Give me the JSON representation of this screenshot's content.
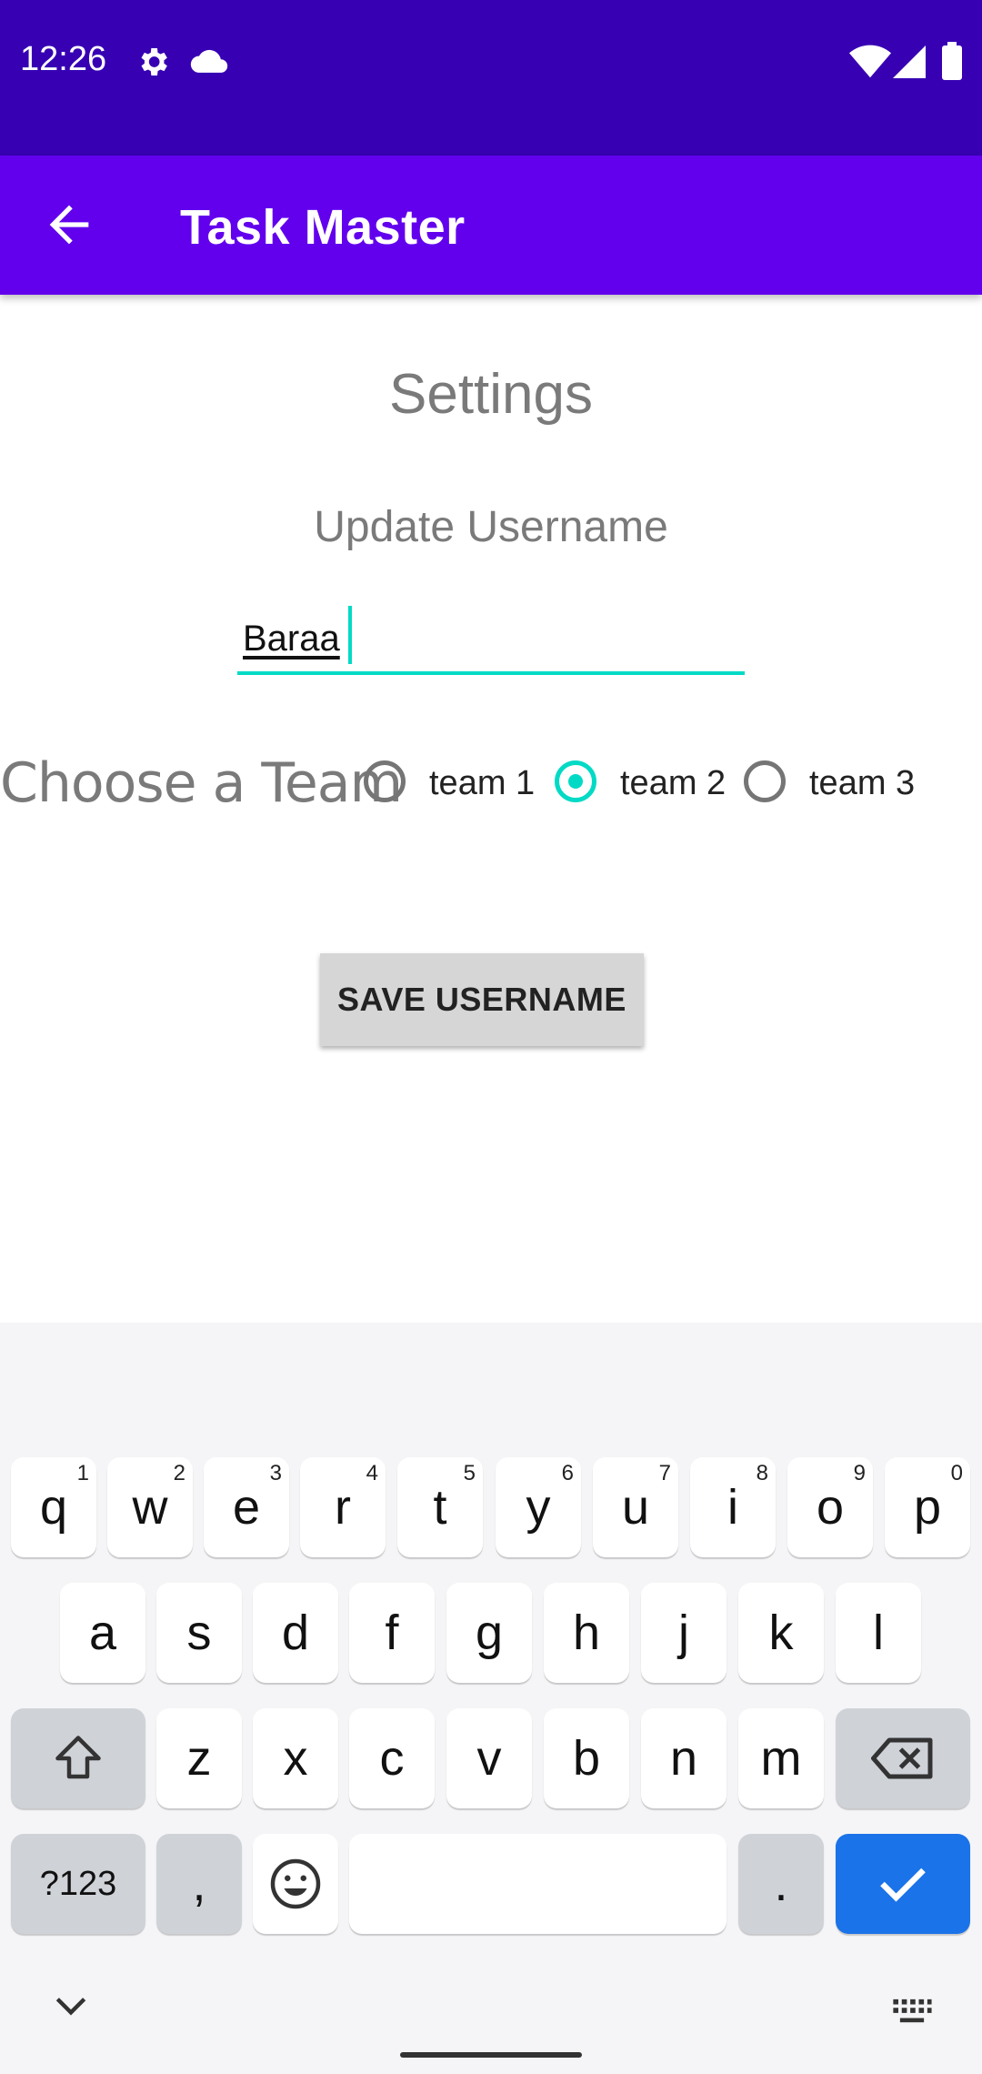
{
  "status_bar": {
    "time": "12:26",
    "icons": [
      "gear-icon",
      "cloud-icon",
      "wifi-icon",
      "signal-icon",
      "battery-icon"
    ]
  },
  "app_bar": {
    "title": "Task Master",
    "back_icon": "arrow-back-icon"
  },
  "page": {
    "heading": "Settings",
    "username_label": "Update Username",
    "username_value": "Baraa",
    "team_label": "Choose a Team",
    "teams": [
      {
        "label": "team 1",
        "checked": false
      },
      {
        "label": "team 2",
        "checked": true
      },
      {
        "label": "team 3",
        "checked": false
      }
    ],
    "save_button": "SAVE USERNAME"
  },
  "keyboard": {
    "row1": [
      {
        "key": "q",
        "hint": "1"
      },
      {
        "key": "w",
        "hint": "2"
      },
      {
        "key": "e",
        "hint": "3"
      },
      {
        "key": "r",
        "hint": "4"
      },
      {
        "key": "t",
        "hint": "5"
      },
      {
        "key": "y",
        "hint": "6"
      },
      {
        "key": "u",
        "hint": "7"
      },
      {
        "key": "i",
        "hint": "8"
      },
      {
        "key": "o",
        "hint": "9"
      },
      {
        "key": "p",
        "hint": "0"
      }
    ],
    "row2": [
      "a",
      "s",
      "d",
      "f",
      "g",
      "h",
      "j",
      "k",
      "l"
    ],
    "row3": [
      "z",
      "x",
      "c",
      "v",
      "b",
      "n",
      "m"
    ],
    "symbols_key": "?123",
    "comma_key": ",",
    "period_key": "."
  },
  "colors": {
    "status_bar": "#3700B3",
    "app_bar": "#6200EE",
    "accent": "#03DAC5",
    "enter_key": "#1a73e8"
  }
}
